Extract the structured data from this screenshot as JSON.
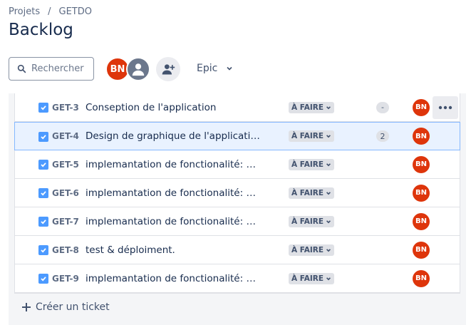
{
  "breadcrumb": {
    "projects": "Projets",
    "separator": "/",
    "project": "GETDO"
  },
  "page": {
    "title": "Backlog"
  },
  "toolbar": {
    "search_placeholder": "Rechercher",
    "avatar_initials": "BN",
    "epic_label": "Epic"
  },
  "issues": [
    {
      "key": "GET-3",
      "summary": "Conseption de l'application",
      "status": "À FAIRE",
      "points": "-",
      "assignee": "BN"
    },
    {
      "key": "GET-4",
      "summary": "Design de graphique de l'application",
      "status": "À FAIRE",
      "points": "2",
      "assignee": "BN"
    },
    {
      "key": "GET-5",
      "summary": "implemantation de fonctionalité: Cre…",
      "status": "À FAIRE",
      "points": "",
      "assignee": "BN"
    },
    {
      "key": "GET-6",
      "summary": "implemantation de fonctionalité: Visi…",
      "status": "À FAIRE",
      "points": "",
      "assignee": "BN"
    },
    {
      "key": "GET-7",
      "summary": "implemantation de fonctionalité: Das…",
      "status": "À FAIRE",
      "points": "",
      "assignee": "BN"
    },
    {
      "key": "GET-8",
      "summary": "test & déploiment.",
      "status": "À FAIRE",
      "points": "",
      "assignee": "BN"
    },
    {
      "key": "GET-9",
      "summary": "implemantation de fonctionalité: Aut…",
      "status": "À FAIRE",
      "points": "",
      "assignee": "BN"
    }
  ],
  "footer": {
    "create_label": "Créer un ticket"
  },
  "colors": {
    "accent": "#0c66e4",
    "avatar": "#de350b",
    "checkbox": "#4c9aff",
    "selected_row": "#e9f2ff"
  }
}
